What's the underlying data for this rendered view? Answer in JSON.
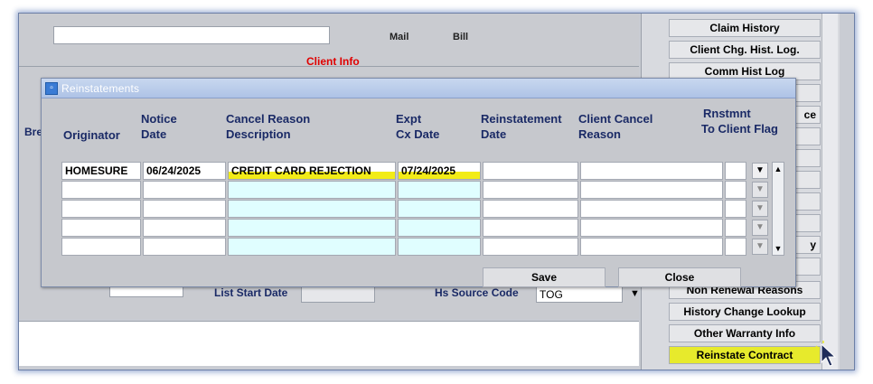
{
  "app": {
    "client_info_label": "Client Info",
    "mail_label": "Mail",
    "bill_label": "Bill",
    "partial_left_label": "Bre",
    "list_start_date_label": "List Start Date",
    "hs_source_code_label": "Hs Source Code",
    "hs_source_code_value": "TOG",
    "partial_field_value": "..."
  },
  "right_panel": {
    "buttons": [
      {
        "label": "Claim History"
      },
      {
        "label": "Client Chg. Hist. Log."
      },
      {
        "label": "Comm Hist Log"
      },
      {
        "label": ""
      },
      {
        "label": "ce"
      },
      {
        "label": ""
      },
      {
        "label": ""
      },
      {
        "label": ""
      },
      {
        "label": ""
      },
      {
        "label": ""
      },
      {
        "label": "y"
      },
      {
        "label": ""
      },
      {
        "label": "Non Renewal Reasons"
      },
      {
        "label": "History Change Lookup"
      },
      {
        "label": "Other Warranty Info"
      },
      {
        "label": "Reinstate Contract"
      }
    ]
  },
  "dialog": {
    "title": "Reinstatements",
    "columns": {
      "originator": "Originator",
      "notice_date_1": "Notice",
      "notice_date_2": "Date",
      "cancel_reason_1": "Cancel Reason",
      "cancel_reason_2": "Description",
      "expt_cx_1": "Expt",
      "expt_cx_2": "Cx Date",
      "reinstatement_1": "Reinstatement",
      "reinstatement_2": "Date",
      "client_cancel_1": "Client Cancel",
      "client_cancel_2": "Reason",
      "rnstmnt_1": "Rnstmnt",
      "rnstmnt_2": "To Client Flag"
    },
    "rows": [
      {
        "originator": "HOMESURE",
        "notice_date": "06/24/2025",
        "cancel_reason": "CREDIT CARD REJECTION",
        "expt_cx_date": "07/24/2025",
        "reinstatement_date": "",
        "client_cancel_reason": "",
        "flag": ""
      },
      {
        "originator": "",
        "notice_date": "",
        "cancel_reason": "",
        "expt_cx_date": "",
        "reinstatement_date": "",
        "client_cancel_reason": "",
        "flag": ""
      },
      {
        "originator": "",
        "notice_date": "",
        "cancel_reason": "",
        "expt_cx_date": "",
        "reinstatement_date": "",
        "client_cancel_reason": "",
        "flag": ""
      },
      {
        "originator": "",
        "notice_date": "",
        "cancel_reason": "",
        "expt_cx_date": "",
        "reinstatement_date": "",
        "client_cancel_reason": "",
        "flag": ""
      },
      {
        "originator": "",
        "notice_date": "",
        "cancel_reason": "",
        "expt_cx_date": "",
        "reinstatement_date": "",
        "client_cancel_reason": "",
        "flag": ""
      }
    ],
    "save_label": "Save",
    "close_label": "Close"
  },
  "colors": {
    "highlight": "#f2ec17",
    "header_text": "#1a2a66",
    "alert_text": "#e00000",
    "cyan_cell": "#e0feff"
  }
}
